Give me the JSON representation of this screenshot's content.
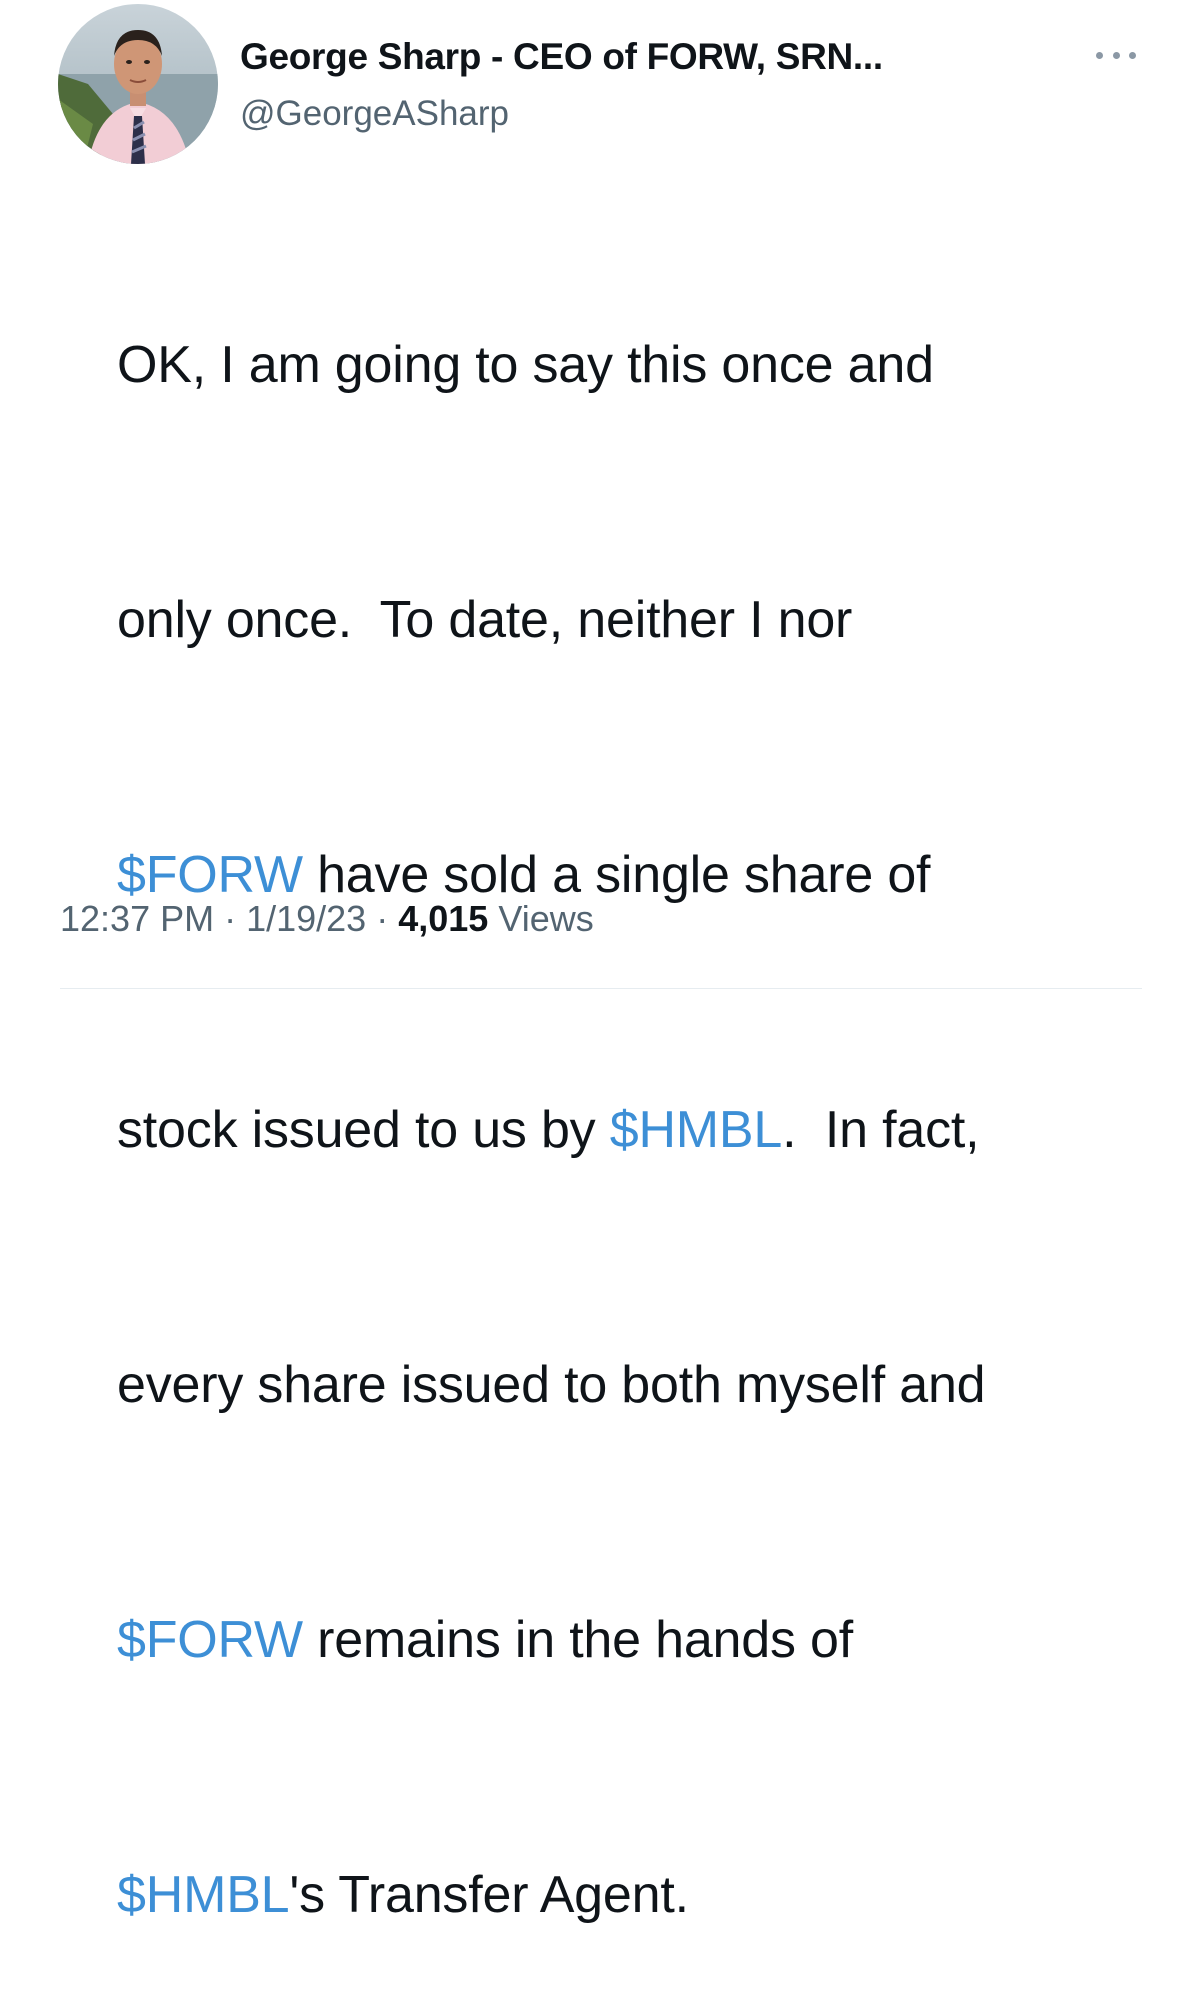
{
  "author": {
    "display_name": "George Sharp - CEO of FORW, SRN...",
    "handle": "@GeorgeASharp"
  },
  "more_icon": "more-horizontal-icon",
  "tweet": {
    "lines": [
      [
        {
          "text": "OK, I am going to say this once and"
        }
      ],
      [
        {
          "text": "only once.  To date, neither I nor"
        }
      ],
      [
        {
          "text": "$FORW",
          "cashtag": true
        },
        {
          "text": " have sold a single share of"
        }
      ],
      [
        {
          "text": "stock issued to us by "
        },
        {
          "text": "$HMBL",
          "cashtag": true
        },
        {
          "text": ".  In fact,"
        }
      ],
      [
        {
          "text": "every share issued to both myself and"
        }
      ],
      [
        {
          "text": "$FORW",
          "cashtag": true
        },
        {
          "text": " remains in the hands of"
        }
      ],
      [
        {
          "text": "$HMBL",
          "cashtag": true
        },
        {
          "text": "'s Transfer Agent."
        }
      ]
    ]
  },
  "meta": {
    "time": "12:37 PM",
    "separator": "·",
    "date": "1/19/23",
    "views_count": "4,015",
    "views_label": "Views"
  },
  "colors": {
    "cashtag": "#3d8fd6",
    "text": "#0f1419",
    "secondary": "#536471"
  }
}
